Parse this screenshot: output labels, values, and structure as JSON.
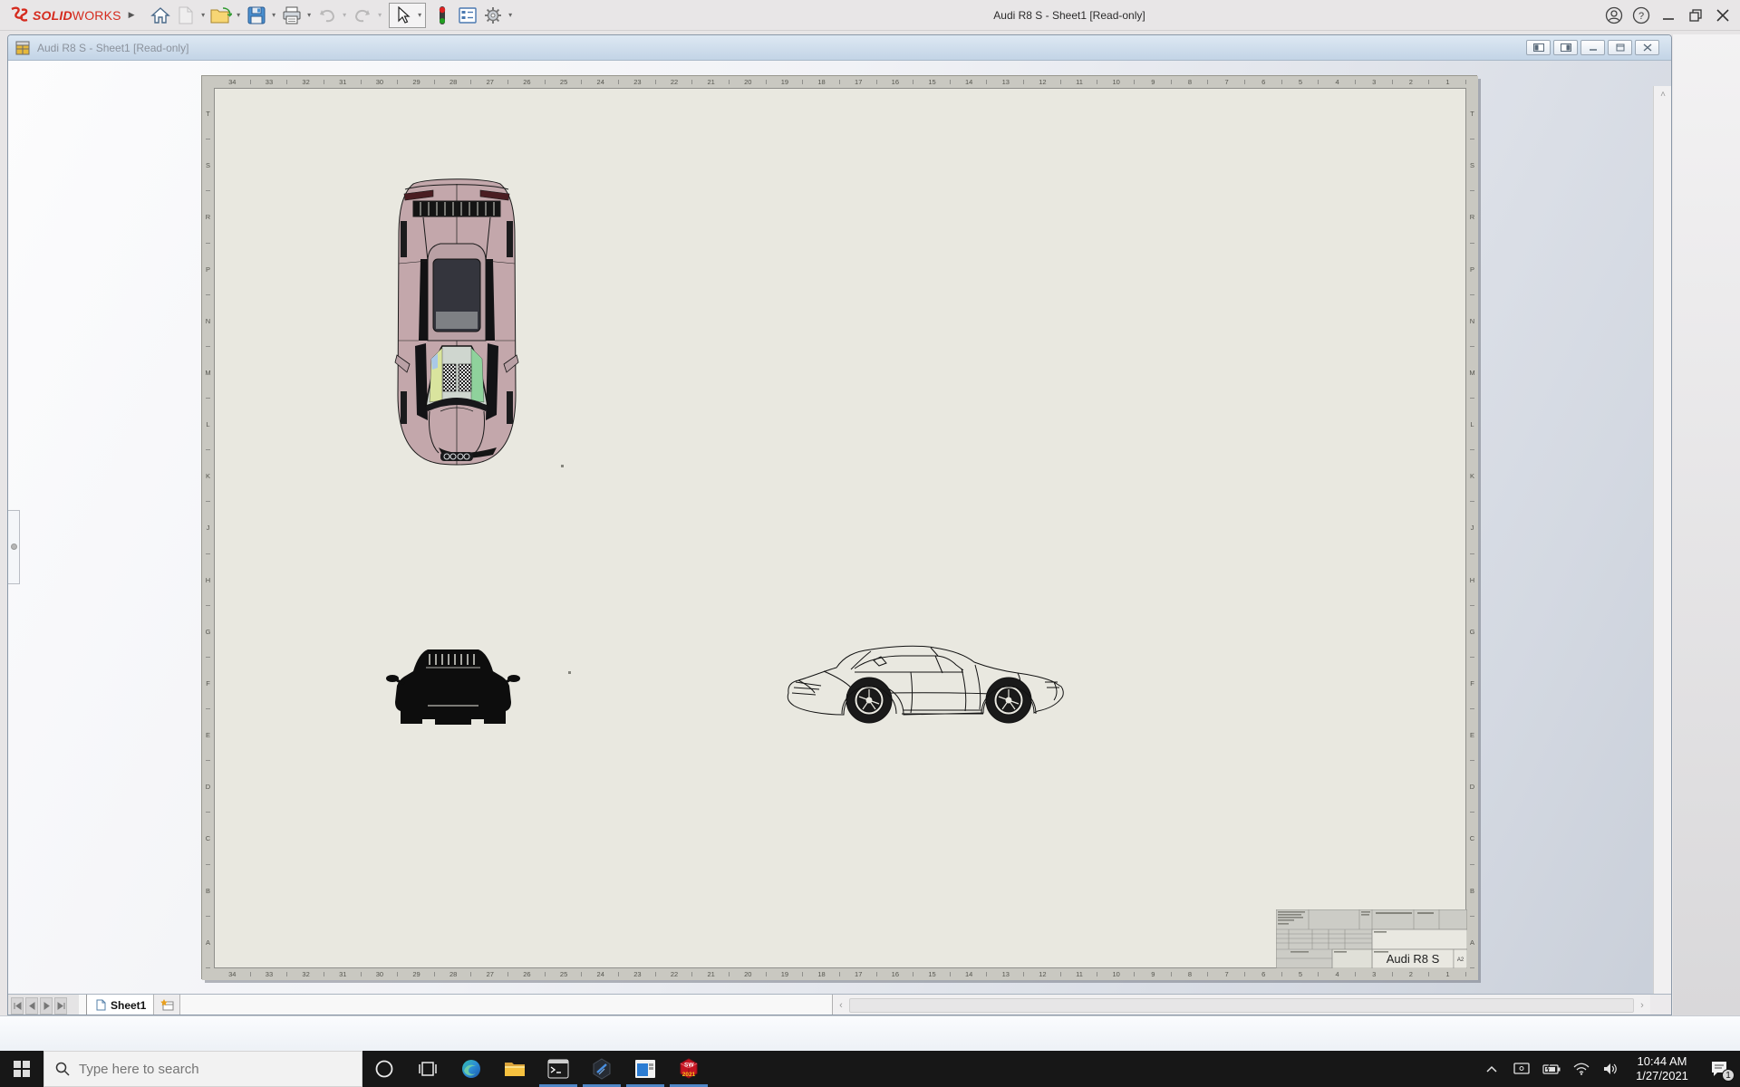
{
  "app": {
    "brand": {
      "bold": "SOLID",
      "light": "WORKS"
    },
    "title": "Audi R8 S - Sheet1 [Read-only]",
    "toolbar_icons": [
      "home",
      "new-document",
      "open",
      "save",
      "print",
      "undo",
      "redo",
      "select",
      "traffic-light",
      "display-pane",
      "options"
    ]
  },
  "doc": {
    "title": "Audi R8 S - Sheet1 [Read-only]"
  },
  "sheet": {
    "zone_columns": [
      "34",
      "33",
      "32",
      "31",
      "30",
      "29",
      "28",
      "27",
      "26",
      "25",
      "24",
      "23",
      "22",
      "21",
      "20",
      "19",
      "18",
      "17",
      "16",
      "15",
      "14",
      "13",
      "12",
      "11",
      "10",
      "9",
      "8",
      "7",
      "6",
      "5",
      "4",
      "3",
      "2",
      "1"
    ],
    "zone_rows": [
      "T",
      "S",
      "R",
      "P",
      "N",
      "M",
      "L",
      "K",
      "J",
      "H",
      "G",
      "F",
      "E",
      "D",
      "C",
      "B",
      "A"
    ],
    "title_block": {
      "part_title": "Audi R8 S",
      "sheet_size": "A2"
    }
  },
  "tabs": {
    "sheet1_label": "Sheet1"
  },
  "taskbar": {
    "search_placeholder": "Type here to search",
    "clock_time": "10:44 AM",
    "clock_date": "1/27/2021",
    "notification_count": "1",
    "solidworks_initials": "SW",
    "solidworks_year": "2021"
  }
}
